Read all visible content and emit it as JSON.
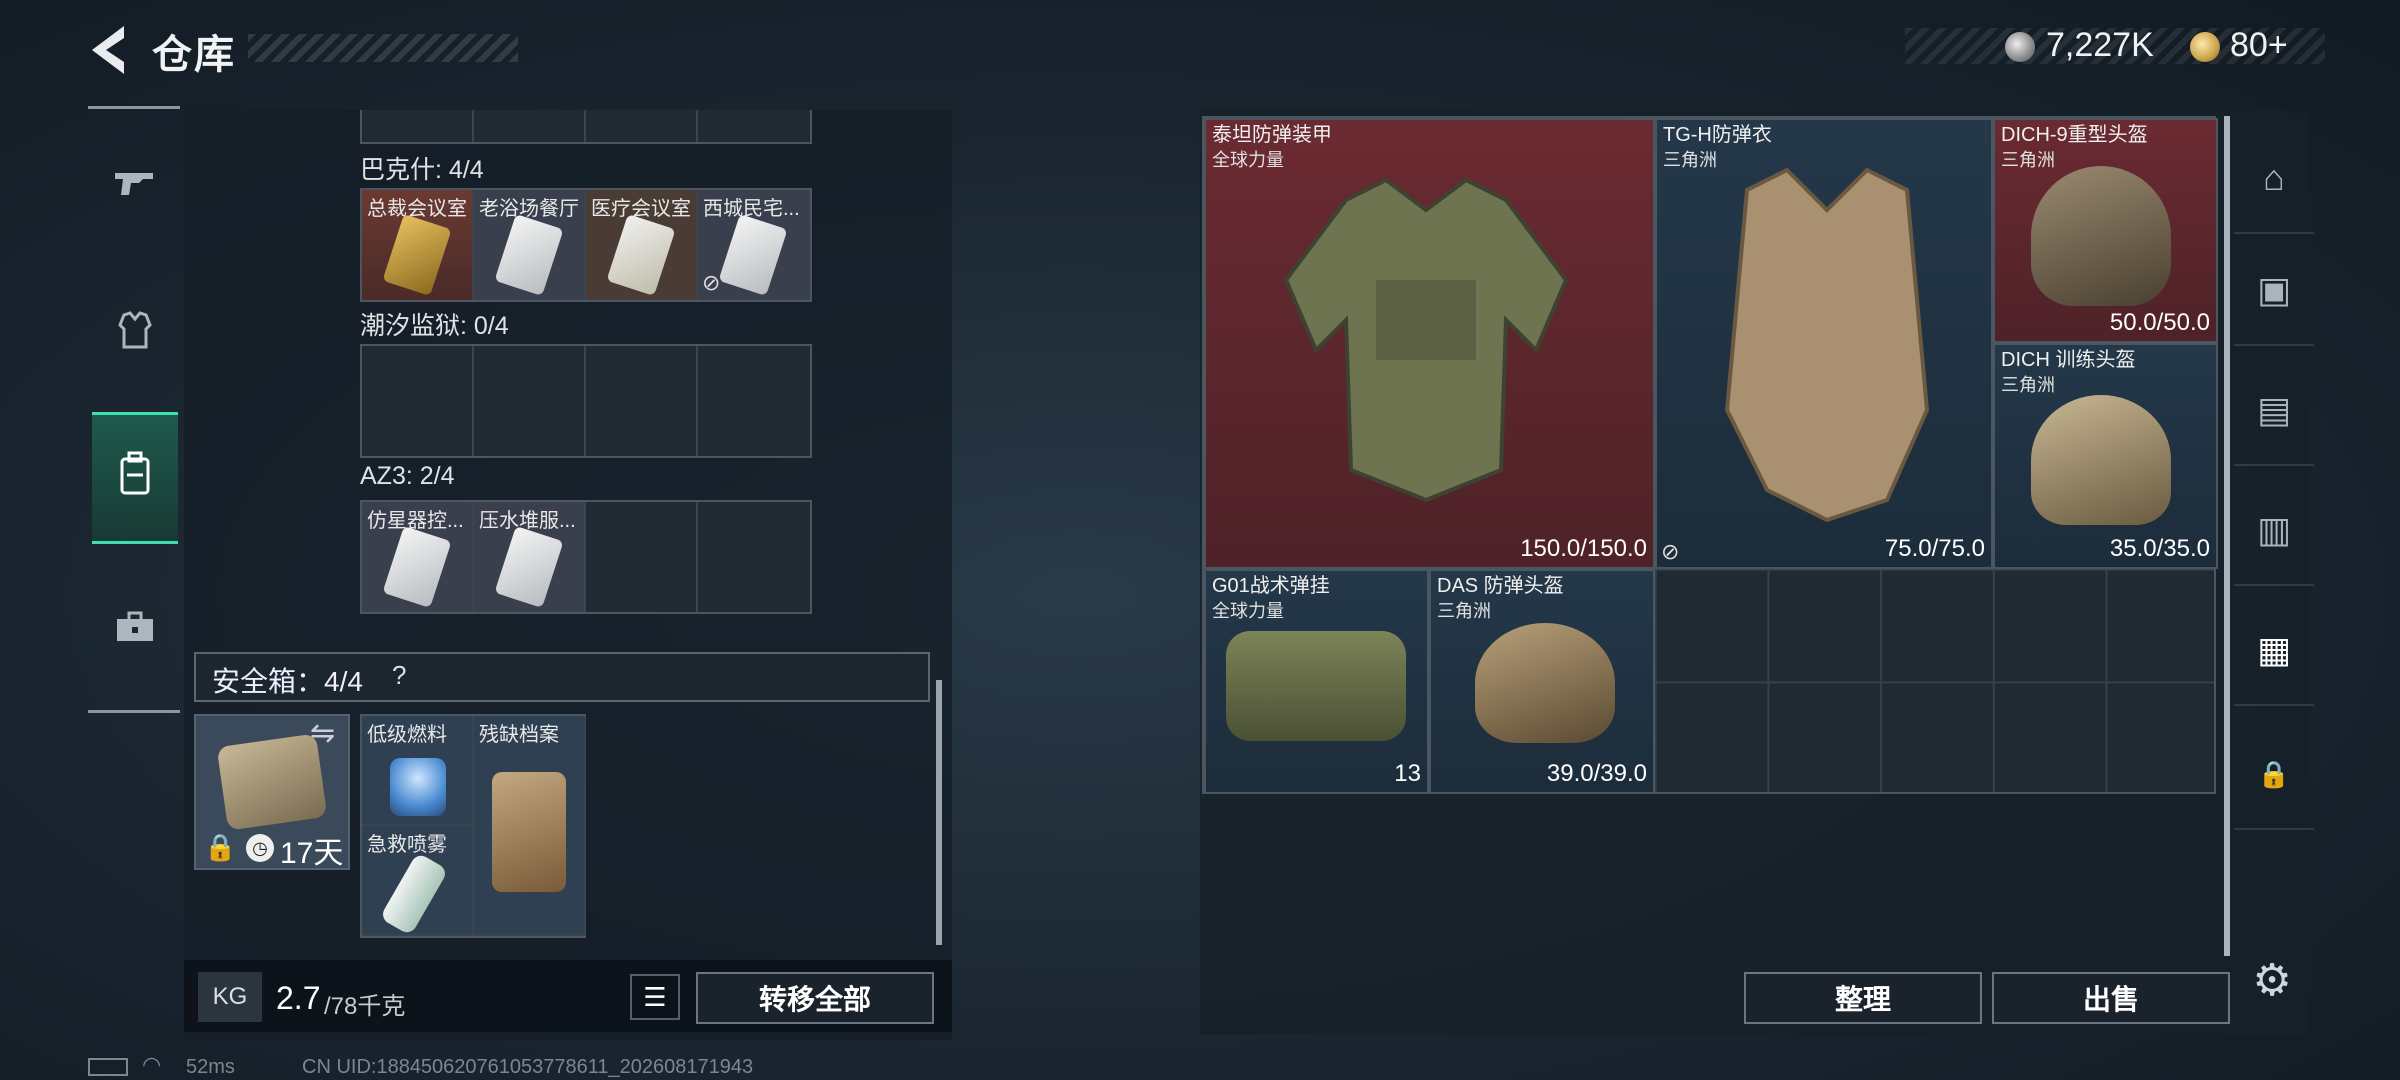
{
  "header": {
    "title": "仓库",
    "silver": "7,227K",
    "gold": "80+"
  },
  "left_nav": {
    "items": [
      "gun-icon",
      "armor-icon",
      "backpack-icon",
      "toolbox-icon"
    ]
  },
  "sections": [
    {
      "label": "巴克什: 4/4",
      "items": [
        {
          "name": "总裁会议室",
          "style": "gold"
        },
        {
          "name": "老浴场餐厅",
          "style": "white"
        },
        {
          "name": "医疗会议室",
          "style": "tan"
        },
        {
          "name": "西城民宅...",
          "style": "white",
          "disabled": true
        }
      ]
    },
    {
      "label": "潮汐监狱: 0/4",
      "items": []
    },
    {
      "label": "AZ3: 2/4",
      "items": [
        {
          "name": "仿星器控...",
          "style": "white"
        },
        {
          "name": "压水堆服...",
          "style": "white"
        }
      ]
    }
  ],
  "safe": {
    "label": "安全箱：4/4",
    "help": "?",
    "days": "17天",
    "items": [
      {
        "name": "低级燃料"
      },
      {
        "name": "残缺档案"
      },
      {
        "name": "急救喷雾"
      }
    ]
  },
  "weight": {
    "current": "2.7",
    "max": "/78千克",
    "kg_label": "KG"
  },
  "buttons": {
    "transfer": "转移全部",
    "sort": "整理",
    "sell": "出售"
  },
  "stash_items": [
    {
      "name": "泰坦防弹装甲",
      "sub": "全球力量",
      "dur": "150.0/150.0",
      "style": "red"
    },
    {
      "name": "TG-H防弹衣",
      "sub": "三角洲",
      "dur": "75.0/75.0",
      "style": "navy"
    },
    {
      "name": "DICH-9重型头盔",
      "sub": "三角洲",
      "dur": "50.0/50.0",
      "style": "red"
    },
    {
      "name": "DICH 训练头盔",
      "sub": "三角洲",
      "dur": "35.0/35.0",
      "style": "navy"
    },
    {
      "name": "G01战术弹挂",
      "sub": "全球力量",
      "dur": "13",
      "style": "navy"
    },
    {
      "name": "DAS 防弹头盔",
      "sub": "三角洲",
      "dur": "39.0/39.0",
      "style": "navy"
    }
  ],
  "status": {
    "ping": "52ms",
    "uid": "CN UID:188450620761053778611_202608171943"
  },
  "colors": {
    "accent": "#3fe0b0",
    "red_item": "#6b2a32",
    "navy_item": "#24384a"
  }
}
